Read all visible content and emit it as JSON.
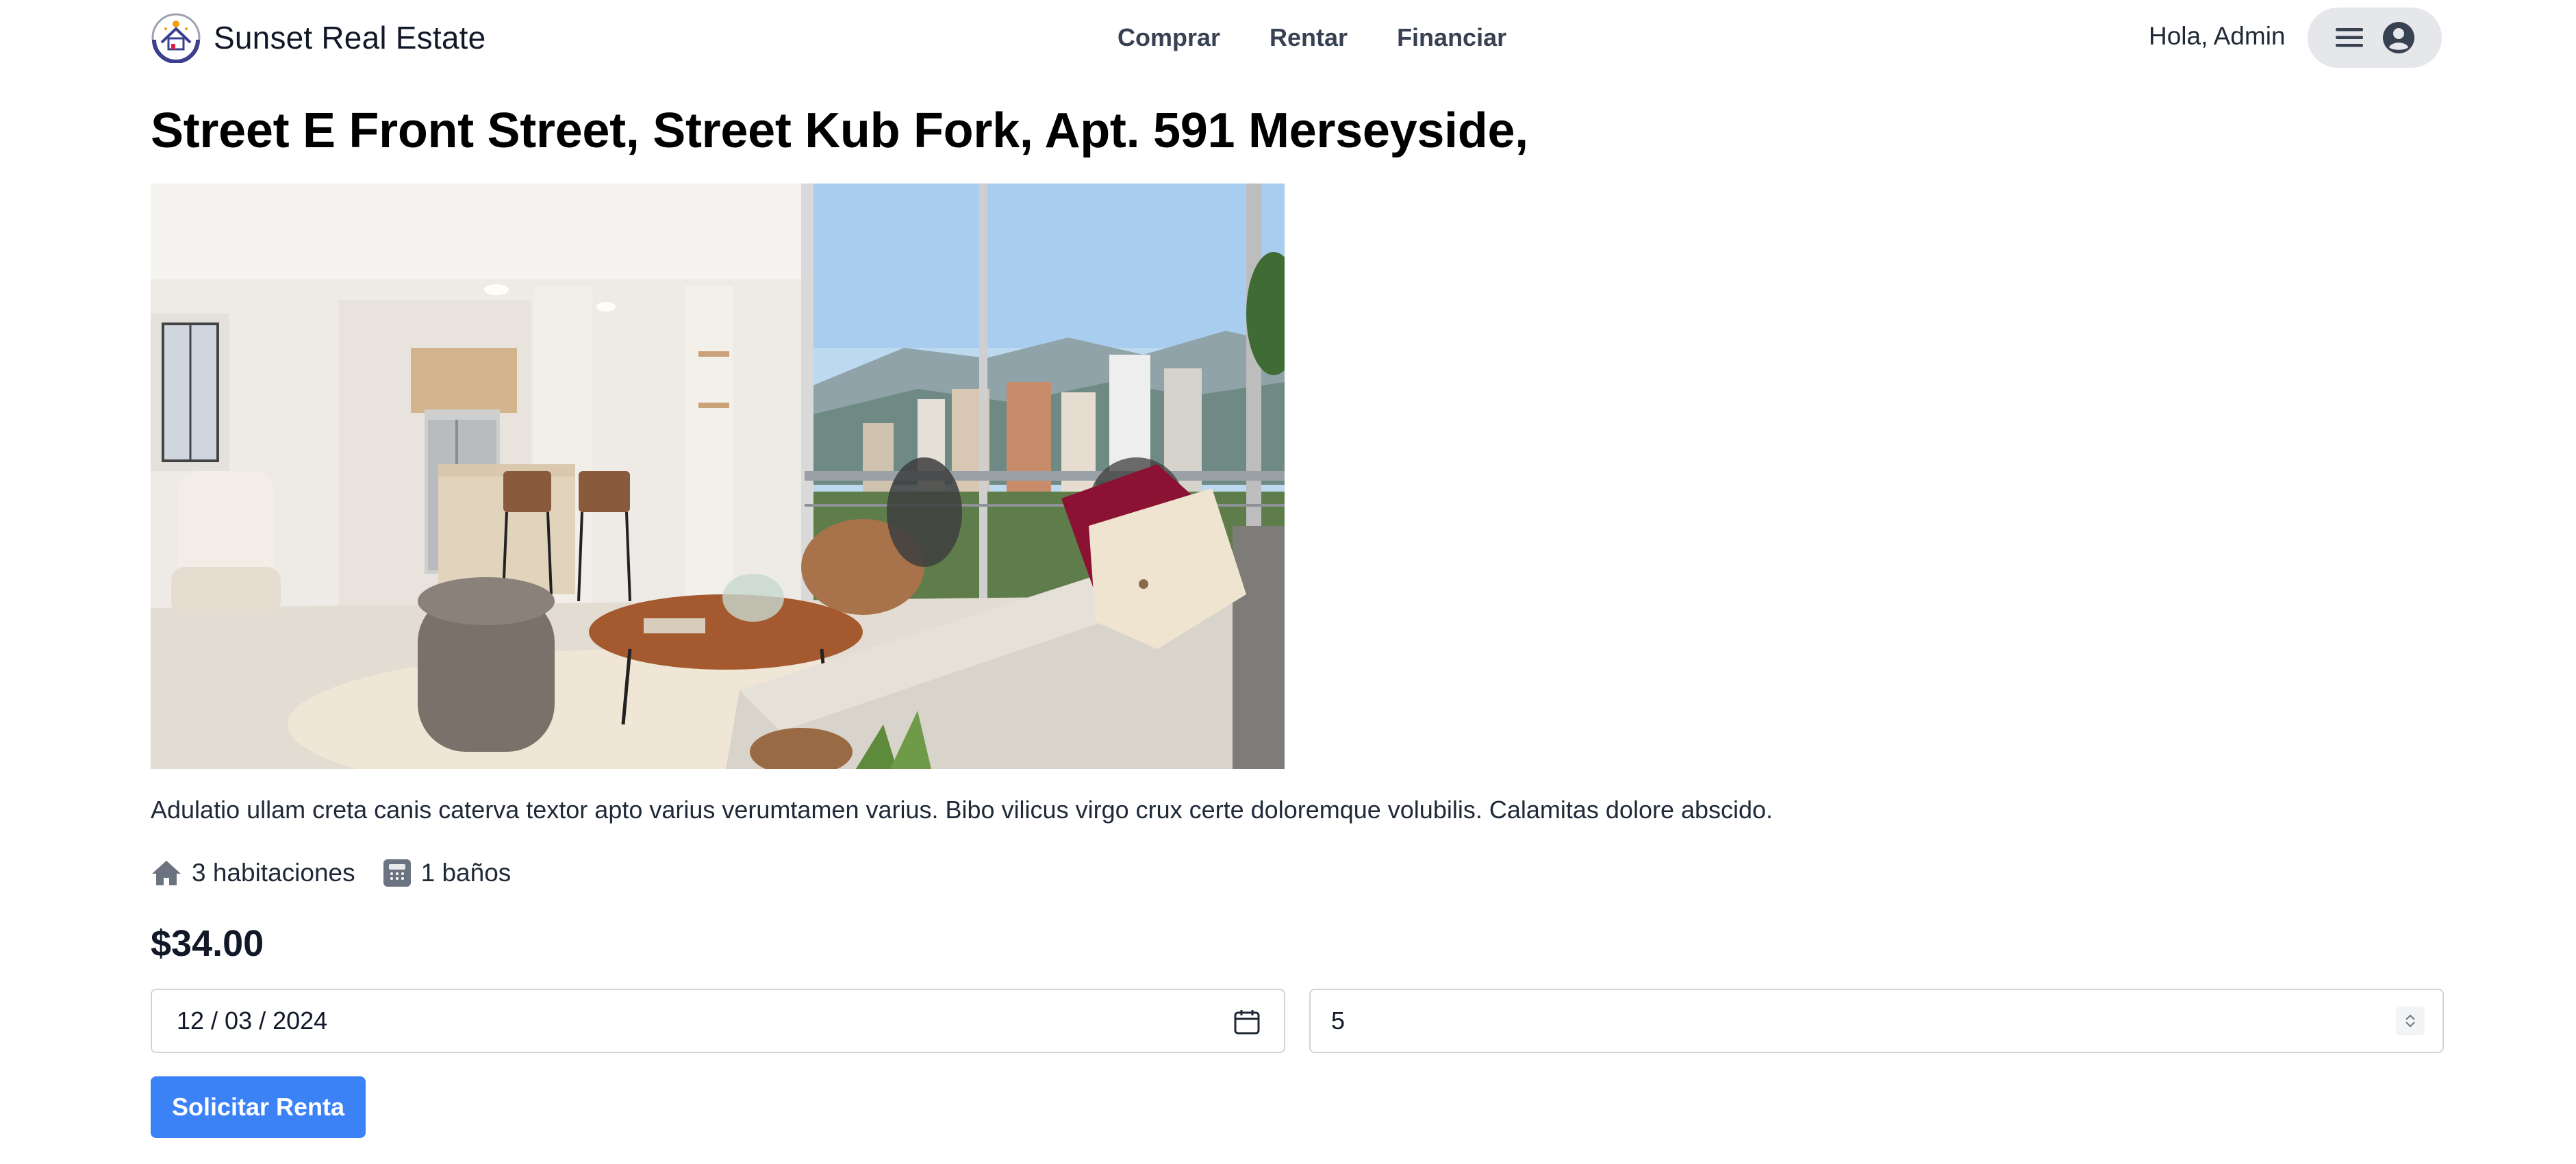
{
  "brand": {
    "name": "Sunset Real Estate",
    "logo_icon": "house-sunset-logo"
  },
  "nav": {
    "items": [
      {
        "label": "Comprar"
      },
      {
        "label": "Rentar"
      },
      {
        "label": "Financiar"
      }
    ]
  },
  "user": {
    "greeting": "Hola, Admin",
    "menu_icon": "hamburger-icon",
    "avatar_icon": "user-circle-icon"
  },
  "listing": {
    "title": "Street E Front Street, Street Kub Fork, Apt. 591 Merseyside,",
    "description": "Adulatio ullam creta canis caterva textor apto varius verumtamen varius. Bibo vilicus virgo crux certe doloremque volubilis. Calamitas dolore abscido.",
    "bedrooms": "3 habitaciones",
    "bathrooms": "1 baños",
    "price": "$34.00"
  },
  "form": {
    "date_value": "12 / 03 / 2024",
    "quantity_value": "5",
    "submit_label": "Solicitar Renta"
  },
  "colors": {
    "primary_button": "#3b82f6",
    "user_menu_bg": "#e5e7eb",
    "icon_gray": "#6b7280"
  }
}
